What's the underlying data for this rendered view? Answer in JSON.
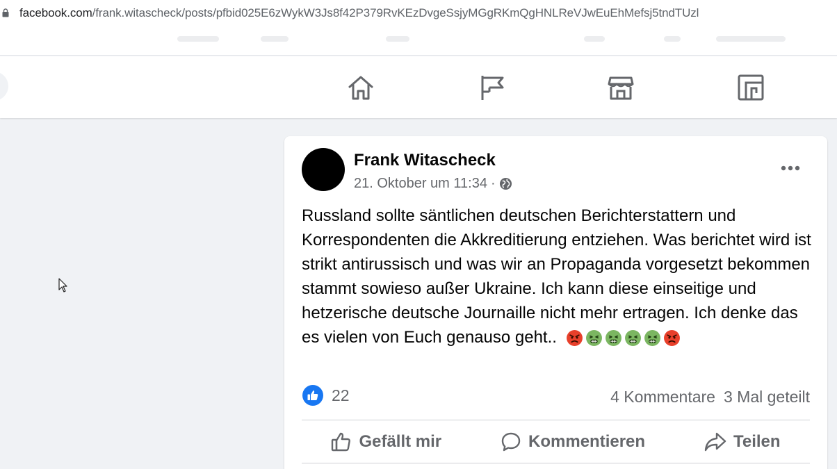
{
  "browser": {
    "url_host": "facebook.com",
    "url_path": "/frank.witascheck/posts/pfbid025E6zWykW3Js8f42P379RvKEzDvgeSsjyMGgRKmQgHNLReVJwEuEhMefsj5tndTUzl"
  },
  "nav": {
    "icons": [
      "home-icon",
      "pages-flag-icon",
      "marketplace-icon",
      "gaming-icon"
    ]
  },
  "post": {
    "author": "Frank Witascheck",
    "timestamp": "21. Oktober um 11:34",
    "separator": "·",
    "privacy_icon": "globe-icon",
    "text": "Russland sollte säntlichen deutschen Berichterstattern und Korrespondenten die Akkreditierung entziehen. Was berichtet wird ist strikt antirussisch und was wir an Propaganda vorgesetzt bekommen stammt sowieso außer Ukraine. Ich kann diese einseitige und hetzerische deutsche Journaille nicht mehr ertragen. Ich denke das es vielen von Euch genauso geht..",
    "emojis": [
      "angry",
      "nauseated",
      "nauseated",
      "nauseated",
      "nauseated",
      "angry"
    ],
    "likes_count": "22",
    "comments_label": "4 Kommentare",
    "shares_label": "3 Mal geteilt",
    "actions": {
      "like": "Gefällt mir",
      "comment": "Kommentieren",
      "share": "Teilen"
    }
  },
  "colors": {
    "brand_blue": "#1877f2",
    "secondary_text": "#65676b",
    "background": "#f0f2f5"
  }
}
